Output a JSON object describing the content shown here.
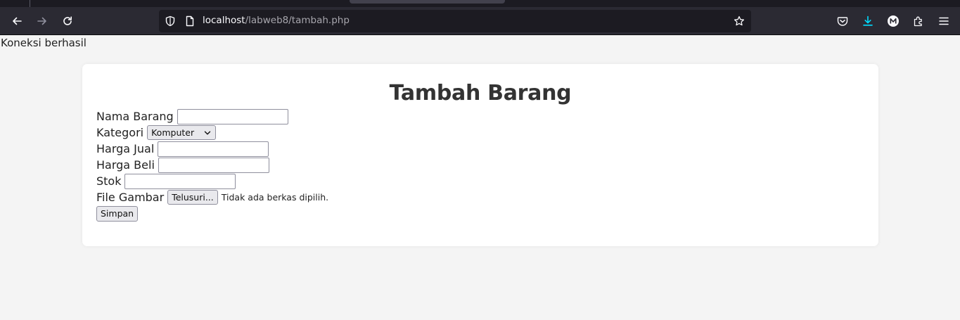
{
  "browser": {
    "url_host": "localhost",
    "url_path": "/labweb8/tambah.php"
  },
  "page": {
    "connection_message": "Koneksi berhasil",
    "title": "Tambah Barang"
  },
  "form": {
    "nama_barang_label": "Nama Barang",
    "nama_barang_value": "",
    "kategori_label": "Kategori",
    "kategori_selected": "Komputer",
    "harga_jual_label": "Harga Jual",
    "harga_jual_value": "",
    "harga_beli_label": "Harga Beli",
    "harga_beli_value": "",
    "stok_label": "Stok",
    "stok_value": "",
    "file_gambar_label": "File Gambar",
    "browse_button": "Telusuri...",
    "no_file_text": "Tidak ada berkas dipilih.",
    "submit_button": "Simpan"
  },
  "icons": {
    "back": "back-arrow-icon",
    "forward": "forward-arrow-icon",
    "reload": "reload-icon",
    "shield": "shield-icon",
    "page": "page-icon",
    "bookmark": "star-icon",
    "pocket": "pocket-icon",
    "downloads": "download-icon",
    "account": "account-icon",
    "extensions": "extensions-icon",
    "menu": "menu-icon"
  },
  "colors": {
    "toolbar": "#2b2a33",
    "urlbar": "#1c1b22",
    "download_accent": "#00ddff",
    "page_bg": "#f4f4f4",
    "card_bg": "#ffffff"
  }
}
